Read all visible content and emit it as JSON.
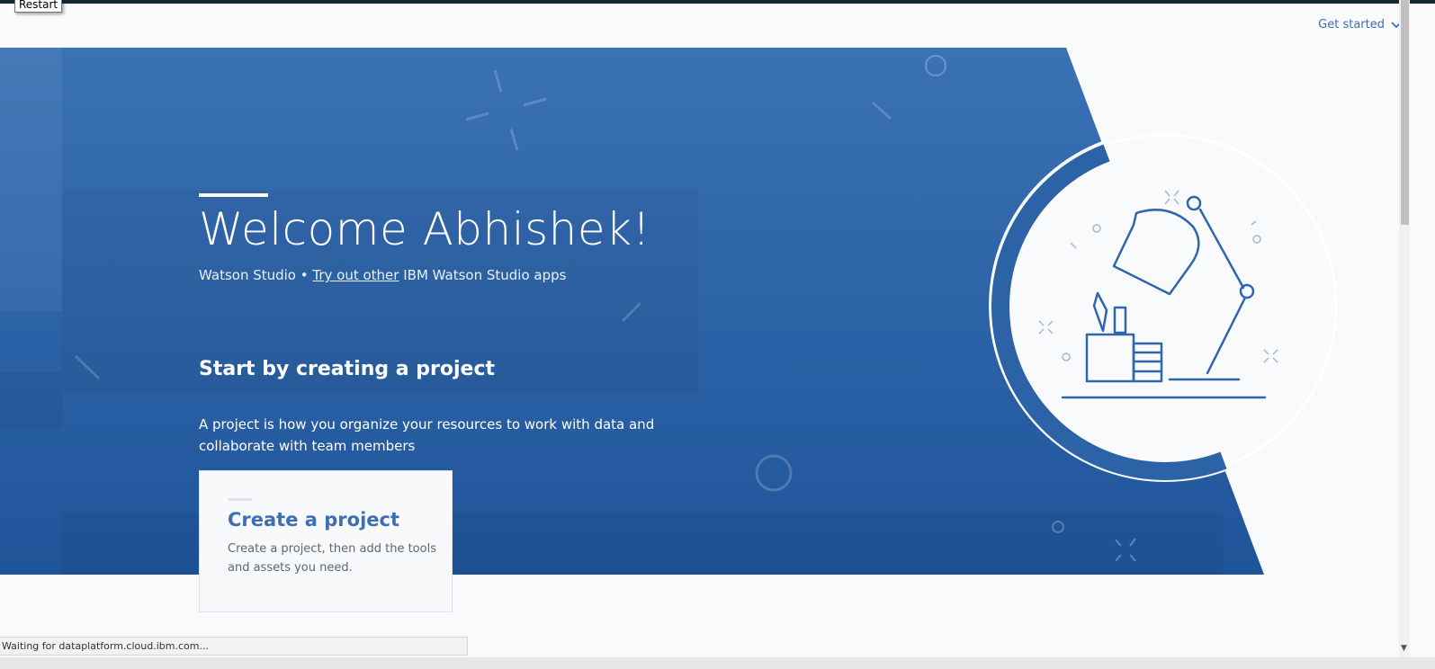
{
  "tooltip": "Restart",
  "header": {
    "get_started": "Get started"
  },
  "hero": {
    "welcome": "Welcome Abhishek!",
    "product": "Watson Studio",
    "separator": " • ",
    "link": "Try out other",
    "link_suffix": " IBM Watson Studio apps",
    "start_heading": "Start by creating a project",
    "description": "A project is how you organize your resources to work with data and collaborate with team members"
  },
  "card": {
    "title": "Create a project",
    "description": "Create a project, then add the tools and assets you need."
  },
  "status": {
    "text": "Waiting for dataplatform.cloud.ibm.com..."
  },
  "colors": {
    "hero_blue": "#2c62a6",
    "hero_blue_light": "#346fb3",
    "accent": "#3d70b2",
    "background": "#f9fafb"
  },
  "icons": [
    "chevron-down-icon",
    "desk-lamp-illustration",
    "pencil-cup-icon",
    "books-icon"
  ]
}
